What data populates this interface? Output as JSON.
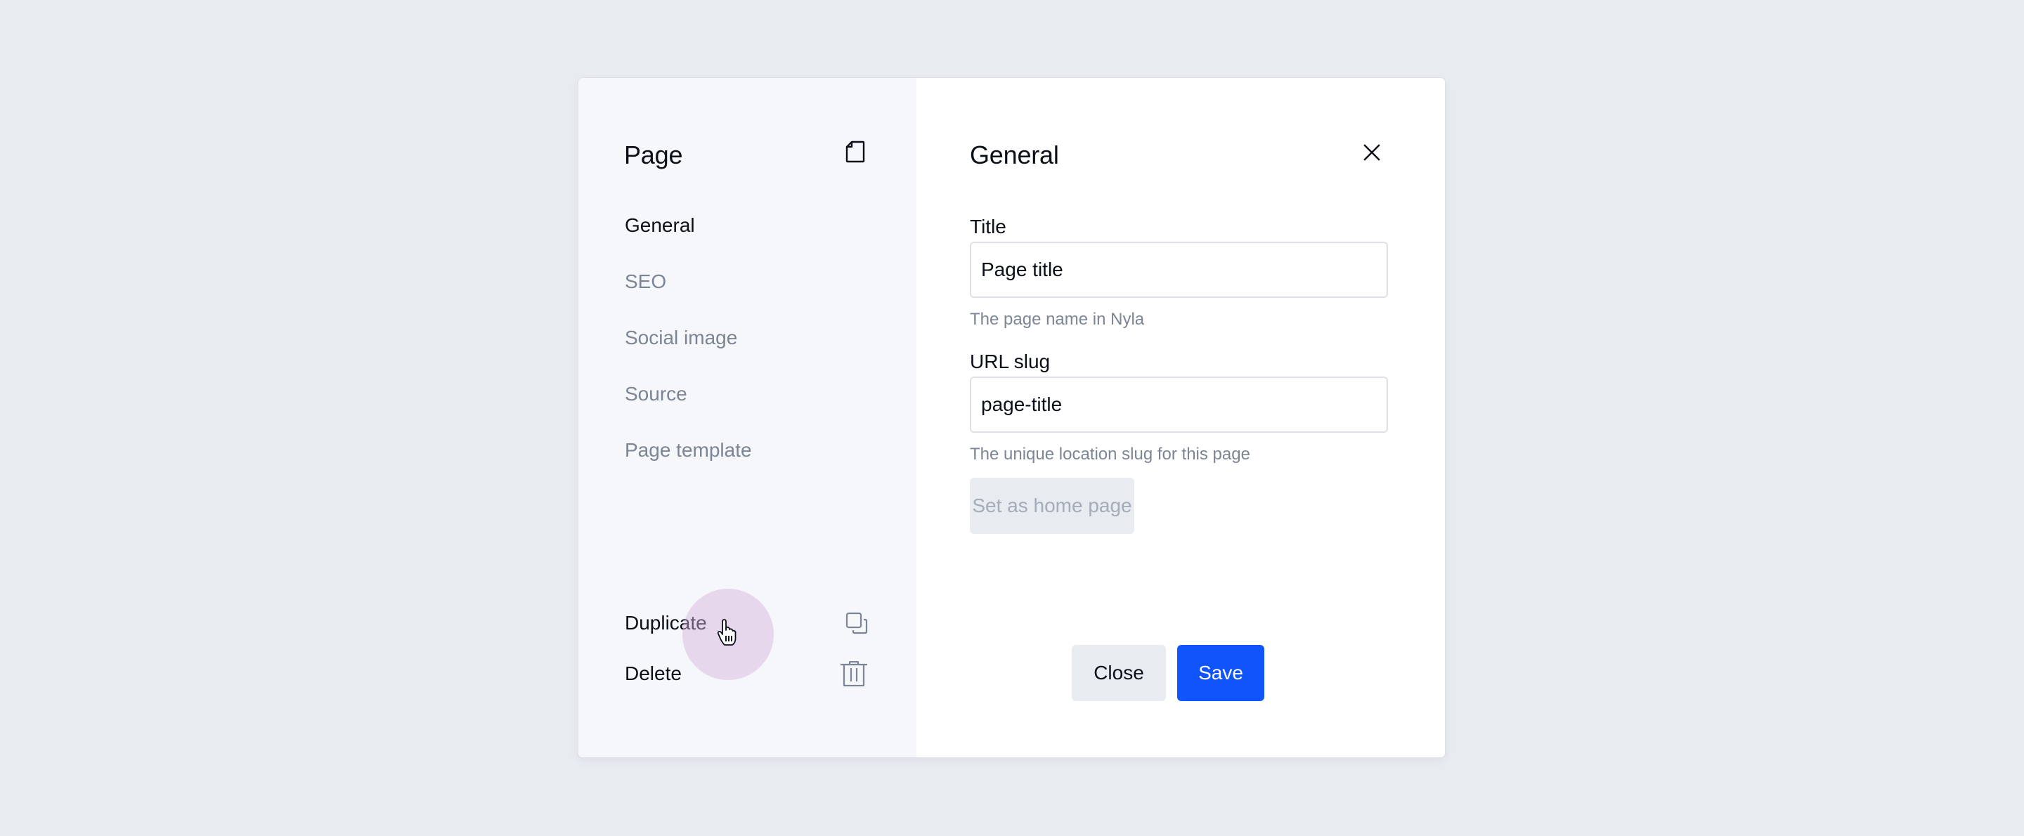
{
  "sidebar": {
    "title": "Page",
    "title_icon": "page-icon",
    "nav": [
      {
        "label": "General",
        "active": true
      },
      {
        "label": "SEO",
        "active": false
      },
      {
        "label": "Social image",
        "active": false
      },
      {
        "label": "Source",
        "active": false
      },
      {
        "label": "Page template",
        "active": false
      }
    ],
    "actions": [
      {
        "label": "Duplicate",
        "icon": "duplicate-icon"
      },
      {
        "label": "Delete",
        "icon": "trash-icon"
      }
    ]
  },
  "main": {
    "title": "General",
    "close_icon": "close-icon",
    "fields": {
      "title": {
        "label": "Title",
        "value": "Page title",
        "helper": "The page name in Nyla"
      },
      "slug": {
        "label": "URL slug",
        "value": "page-title",
        "helper": "The unique location slug for this page"
      }
    },
    "home_button": "Set as home page",
    "footer": {
      "close_label": "Close",
      "save_label": "Save"
    }
  },
  "colors": {
    "accent": "#0f55fb",
    "background": "#e8ebf0",
    "sidebar": "#f5f7fa",
    "muted_text": "#7b8594",
    "cursor_halo": "#e9d7ee"
  }
}
